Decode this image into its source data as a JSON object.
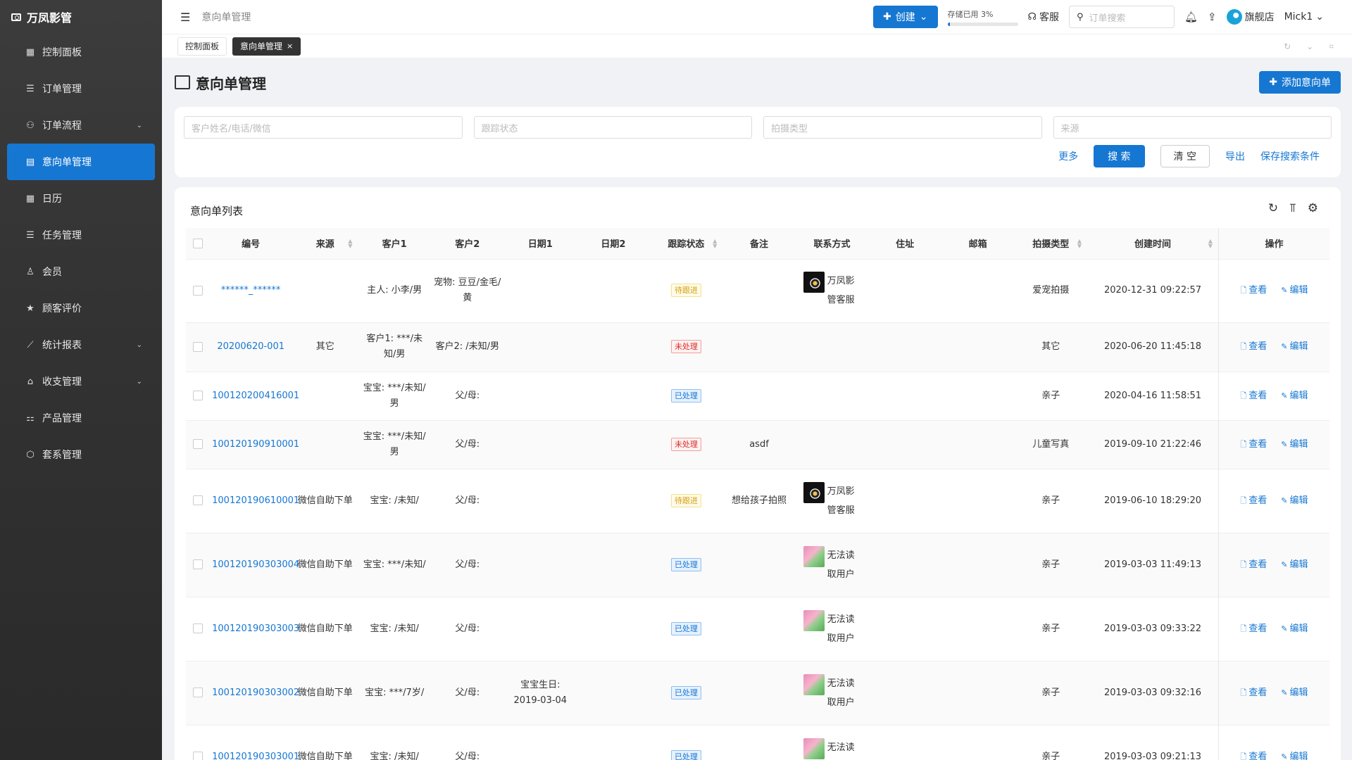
{
  "app": {
    "brand": "万凤影管"
  },
  "sidebar": {
    "items": [
      {
        "label": "控制面板",
        "icon": "dashboard-icon",
        "glyph": "▦",
        "expandable": false,
        "active": false
      },
      {
        "label": "订单管理",
        "icon": "list-icon",
        "glyph": "☰",
        "expandable": false,
        "active": false
      },
      {
        "label": "订单流程",
        "icon": "flow-icon",
        "glyph": "⚇",
        "expandable": true,
        "active": false
      },
      {
        "label": "意向单管理",
        "icon": "doc-icon",
        "glyph": "▤",
        "expandable": false,
        "active": true
      },
      {
        "label": "日历",
        "icon": "calendar-icon",
        "glyph": "▦",
        "expandable": false,
        "active": false
      },
      {
        "label": "任务管理",
        "icon": "task-icon",
        "glyph": "☰",
        "expandable": false,
        "active": false
      },
      {
        "label": "会员",
        "icon": "user-icon",
        "glyph": "♙",
        "expandable": false,
        "active": false
      },
      {
        "label": "顾客评价",
        "icon": "star-icon",
        "glyph": "★",
        "expandable": false,
        "active": false
      },
      {
        "label": "统计报表",
        "icon": "chart-icon",
        "glyph": "⟋",
        "expandable": true,
        "active": false
      },
      {
        "label": "收支管理",
        "icon": "bank-icon",
        "glyph": "⌂",
        "expandable": true,
        "active": false
      },
      {
        "label": "产品管理",
        "icon": "product-icon",
        "glyph": "⚏",
        "expandable": false,
        "active": false
      },
      {
        "label": "套系管理",
        "icon": "package-icon",
        "glyph": "⬡",
        "expandable": false,
        "active": false
      }
    ]
  },
  "header": {
    "breadcrumb": "意向单管理",
    "create_label": "创建",
    "storage_label": "存储已用 3%",
    "storage_percent": 3,
    "service_label": "客服",
    "search_placeholder": "订单搜索",
    "store_label": "旗舰店",
    "user_name": "Mick1"
  },
  "tabs": [
    {
      "label": "控制面板",
      "active": false,
      "closable": false
    },
    {
      "label": "意向单管理",
      "active": true,
      "closable": true
    }
  ],
  "page": {
    "title": "意向单管理",
    "add_label": "添加意向单"
  },
  "filters": {
    "placeholders": [
      "客户姓名/电话/微信",
      "跟踪状态",
      "拍摄类型",
      "来源"
    ],
    "more_label": "更多",
    "search_label": "搜 索",
    "clear_label": "清 空",
    "export_label": "导出",
    "save_label": "保存搜索条件"
  },
  "table": {
    "title": "意向单列表",
    "columns": [
      {
        "label": "编号",
        "sortable": false
      },
      {
        "label": "来源",
        "sortable": true
      },
      {
        "label": "客户1",
        "sortable": false
      },
      {
        "label": "客户2",
        "sortable": false
      },
      {
        "label": "日期1",
        "sortable": false
      },
      {
        "label": "日期2",
        "sortable": false
      },
      {
        "label": "跟踪状态",
        "sortable": true
      },
      {
        "label": "备注",
        "sortable": false
      },
      {
        "label": "联系方式",
        "sortable": false
      },
      {
        "label": "住址",
        "sortable": false
      },
      {
        "label": "邮箱",
        "sortable": false
      },
      {
        "label": "拍摄类型",
        "sortable": true
      },
      {
        "label": "创建时间",
        "sortable": true
      },
      {
        "label": "操作",
        "sortable": false
      }
    ],
    "view_label": "查看",
    "edit_label": "编辑",
    "rows": [
      {
        "id": "******_******",
        "source": "",
        "c1": "主人: 小李/男",
        "c2": "宠物: 豆豆/金毛/黄",
        "d1": "",
        "d2": "",
        "status": "待跟进",
        "status_type": "pending",
        "note": "",
        "contact": {
          "avatar": "brand",
          "text": "万凤影管客服"
        },
        "address": "",
        "email": "",
        "type": "爱宠拍摄",
        "created": "2020-12-31 09:22:57",
        "height": 90
      },
      {
        "id": "20200620-001",
        "source": "其它",
        "c1": "客户1: ***/未知/男",
        "c2": "客户2: /未知/男",
        "d1": "",
        "d2": "",
        "status": "未处理",
        "status_type": "unhandled",
        "note": "",
        "contact": null,
        "address": "",
        "email": "",
        "type": "其它",
        "created": "2020-06-20 11:45:18",
        "height": 70
      },
      {
        "id": "100120200416001",
        "source": "",
        "c1": "宝宝: ***/未知/男",
        "c2": "父/母:",
        "d1": "",
        "d2": "",
        "status": "已处理",
        "status_type": "handled",
        "note": "",
        "contact": null,
        "address": "",
        "email": "",
        "type": "亲子",
        "created": "2020-04-16 11:58:51",
        "height": 69
      },
      {
        "id": "100120190910001",
        "source": "",
        "c1": "宝宝: ***/未知/男",
        "c2": "父/母:",
        "d1": "",
        "d2": "",
        "status": "未处理",
        "status_type": "unhandled",
        "note": "asdf",
        "contact": null,
        "address": "",
        "email": "",
        "type": "儿童写真",
        "created": "2019-09-10 21:22:46",
        "height": 69
      },
      {
        "id": "100120190610001",
        "source": "微信自助下单",
        "c1": "宝宝: /未知/",
        "c2": "父/母:",
        "d1": "",
        "d2": "",
        "status": "待跟进",
        "status_type": "pending",
        "note": "想给孩子拍照",
        "contact": {
          "avatar": "brand",
          "text": "万凤影管客服"
        },
        "address": "",
        "email": "",
        "type": "亲子",
        "created": "2019-06-10 18:29:20",
        "height": 91
      },
      {
        "id": "100120190303004",
        "source": "微信自助下单",
        "c1": "宝宝: ***/未知/",
        "c2": "父/母:",
        "d1": "",
        "d2": "",
        "status": "已处理",
        "status_type": "handled",
        "note": "",
        "contact": {
          "avatar": "user",
          "text": "无法读取用户"
        },
        "address": "",
        "email": "",
        "type": "亲子",
        "created": "2019-03-03 11:49:13",
        "height": 91
      },
      {
        "id": "100120190303003",
        "source": "微信自助下单",
        "c1": "宝宝: /未知/",
        "c2": "父/母:",
        "d1": "",
        "d2": "",
        "status": "已处理",
        "status_type": "handled",
        "note": "",
        "contact": {
          "avatar": "user",
          "text": "无法读取用户"
        },
        "address": "",
        "email": "",
        "type": "亲子",
        "created": "2019-03-03 09:33:22",
        "height": 91
      },
      {
        "id": "100120190303002",
        "source": "微信自助下单",
        "c1": "宝宝: ***/7岁/",
        "c2": "父/母:",
        "d1": "宝宝生日: 2019-03-04",
        "d2": "",
        "status": "已处理",
        "status_type": "handled",
        "note": "",
        "contact": {
          "avatar": "user",
          "text": "无法读取用户"
        },
        "address": "",
        "email": "",
        "type": "亲子",
        "created": "2019-03-03 09:32:16",
        "height": 91
      },
      {
        "id": "100120190303001",
        "source": "微信自助下单",
        "c1": "宝宝: /未知/",
        "c2": "父/母:",
        "d1": "",
        "d2": "",
        "status": "已处理",
        "status_type": "handled",
        "note": "",
        "contact": {
          "avatar": "user",
          "text": "无法读取用户"
        },
        "address": "",
        "email": "",
        "type": "亲子",
        "created": "2019-03-03 09:21:13",
        "height": 91
      }
    ]
  }
}
